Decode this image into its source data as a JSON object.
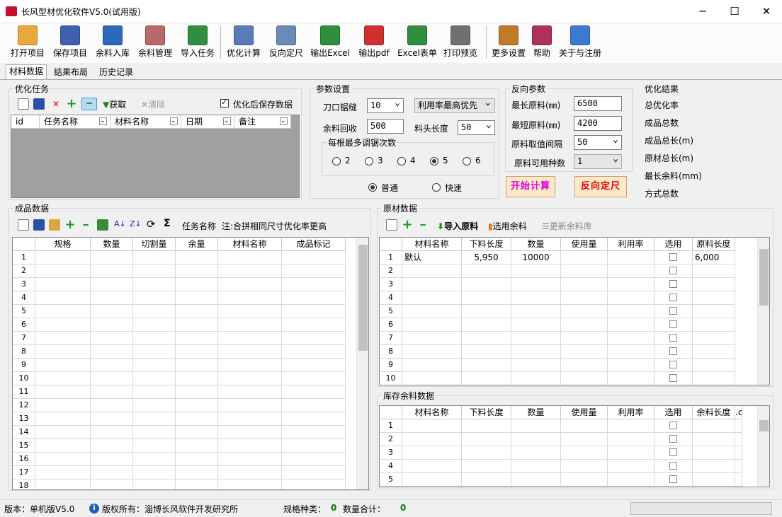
{
  "title": "长风型材优化软件V5.0(试用版)",
  "toolbar": [
    {
      "label": "打开项目",
      "icon": "open-folder-icon"
    },
    {
      "label": "保存项目",
      "icon": "save-disk-icon"
    },
    {
      "label": "余料入库",
      "icon": "stock-in-icon"
    },
    {
      "label": "余料管理",
      "icon": "inventory-icon"
    },
    {
      "label": "导入任务",
      "icon": "excel-import-icon"
    },
    {
      "label": "优化计算",
      "icon": "calculator-icon"
    },
    {
      "label": "反向定尺",
      "icon": "reverse-size-icon"
    },
    {
      "label": "输出Excel",
      "icon": "excel-export-icon"
    },
    {
      "label": "输出pdf",
      "icon": "pdf-icon"
    },
    {
      "label": "Excel表单",
      "icon": "excel-form-icon"
    },
    {
      "label": "打印预览",
      "icon": "printer-icon"
    },
    {
      "label": "更多设置",
      "icon": "tools-icon"
    },
    {
      "label": "帮助",
      "icon": "help-book-icon"
    },
    {
      "label": "关于与注册",
      "icon": "users-icon"
    }
  ],
  "tabs": [
    "材料数据",
    "结果布局",
    "历史记录"
  ],
  "task": {
    "title": "优化任务",
    "fetch": "获取",
    "clear": "清除",
    "save_after": "优化后保存数据",
    "columns": [
      "id",
      "任务名称",
      "材料名称",
      "日期",
      "备注"
    ]
  },
  "params": {
    "title": "参数设置",
    "kerf_label": "刀口锯缝",
    "kerf": "10",
    "mode": "利用率最高优先",
    "recycle_label": "余料回收",
    "recycle": "500",
    "head_label": "料头长度",
    "head": "50",
    "group_title": "每根最多调锯次数",
    "radio_opts": [
      "2",
      "3",
      "4",
      "5",
      "6"
    ],
    "radio_selected": "5",
    "speed_normal": "普通",
    "speed_fast": "快速"
  },
  "reverse": {
    "title": "反向参数",
    "max_label": "最长原料(㎜)",
    "max": "6500",
    "min_label": "最短原料(㎜)",
    "min": "4200",
    "step_label": "原料取值间隔",
    "step": "50",
    "kinds_label": "原料可用种数",
    "kinds": "1"
  },
  "buttons": {
    "start": "开始计算",
    "reverse": "反向定尺"
  },
  "result": {
    "title": "优化结果",
    "items": [
      "总优化率",
      "成品总数",
      "成品总长(m)",
      "原材总长(m)",
      "最长余料(mm)",
      "方式总数"
    ]
  },
  "product": {
    "title": "成品数据",
    "task_label": "任务名称",
    "note": "注:合拼相同尺寸优化率更高",
    "columns": [
      "规格",
      "数量",
      "切割量",
      "余量",
      "材料名称",
      "成品标记"
    ],
    "rows": [
      "1",
      "2",
      "3",
      "4",
      "5",
      "6",
      "7",
      "8",
      "9",
      "10",
      "11",
      "12",
      "13",
      "14",
      "15",
      "16",
      "17",
      "18"
    ]
  },
  "raw": {
    "title": "原材数据",
    "import": "导入原料",
    "select_rem": "选用余料",
    "update_rem": "更新余料库",
    "columns": [
      "材料名称",
      "下料长度",
      "数量",
      "使用量",
      "利用率",
      "选用",
      "原料长度"
    ],
    "rows": [
      {
        "n": "1",
        "name": "默认",
        "cut": "5,950",
        "qty": "10000",
        "len": "6,000"
      },
      {
        "n": "2"
      },
      {
        "n": "3"
      },
      {
        "n": "4"
      },
      {
        "n": "5"
      },
      {
        "n": "6"
      },
      {
        "n": "7"
      },
      {
        "n": "8"
      },
      {
        "n": "9"
      },
      {
        "n": "10"
      }
    ]
  },
  "stock": {
    "title": "库存余料数据",
    "columns": [
      "材料名称",
      "下料长度",
      "数量",
      "使用量",
      "利用率",
      "选用",
      "余料长度",
      ".c"
    ],
    "rows": [
      "1",
      "2",
      "3",
      "4",
      "5"
    ]
  },
  "status": {
    "version": "版本：单机版V5.0",
    "copyright": "版权所有：淄博长风软件开发研究所",
    "kinds_label": "规格种类：",
    "kinds": "0",
    "qty_label": "数量合计：",
    "qty": "0"
  },
  "colors": {
    "accent_magenta": "#e000e0",
    "accent_red": "#e00000",
    "status_green": "#008000"
  }
}
